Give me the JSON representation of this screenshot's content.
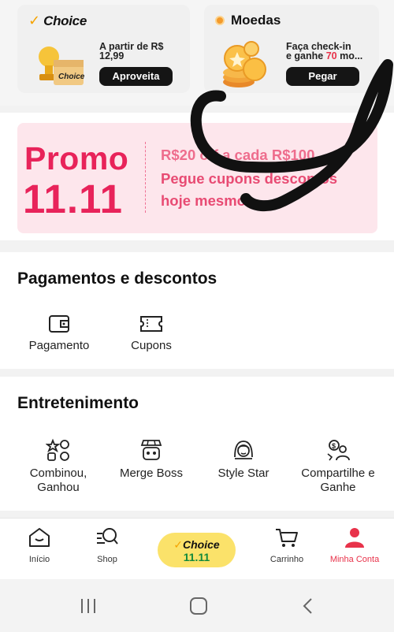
{
  "cards": {
    "choice": {
      "title": "Choice",
      "line1": "A partir de R$",
      "line2": "12,99",
      "button": "Aproveita"
    },
    "coins": {
      "title": "Moedas",
      "line1": "Faça check-in",
      "line2_prefix": "e ganhe ",
      "line2_highlight": "70",
      "line2_suffix": " mo...",
      "button": "Pegar"
    }
  },
  "promo": {
    "word": "Promo",
    "number": "11.11",
    "line1": "R$20 off a cada R$100",
    "line2": "Pegue cupons descontos",
    "line3": "hoje mesmo →"
  },
  "payments": {
    "title": "Pagamentos e descontos",
    "items": [
      {
        "label": "Pagamento",
        "icon": "wallet-icon"
      },
      {
        "label": "Cupons",
        "icon": "ticket-icon"
      }
    ]
  },
  "entertainment": {
    "title": "Entretenimento",
    "items": [
      {
        "label_line1": "Combinou,",
        "label_line2": "Ganhou",
        "icon": "match-game-icon"
      },
      {
        "label_line1": "Merge Boss",
        "label_line2": "",
        "icon": "shop-robot-icon"
      },
      {
        "label_line1": "Style Star",
        "label_line2": "",
        "icon": "girl-face-icon"
      },
      {
        "label_line1": "Compartilhe e",
        "label_line2": "Ganhe",
        "icon": "share-money-icon"
      }
    ]
  },
  "bottom_nav": {
    "items": [
      {
        "label": "Início",
        "icon": "home-icon"
      },
      {
        "label": "Shop",
        "icon": "search-icon"
      },
      {
        "label": "Carrinho",
        "icon": "cart-icon"
      },
      {
        "label": "Minha Conta",
        "icon": "user-icon"
      }
    ],
    "choice_pill": {
      "brand": "Choice",
      "event": "11.11"
    }
  },
  "system_nav": {
    "items": [
      "recent-apps-icon",
      "home-button-icon",
      "back-icon"
    ]
  },
  "colors": {
    "accent_red": "#e8324a",
    "promo_pink": "#e8235a",
    "choice_yellow": "#fbe26a",
    "choice_check": "#f5a300"
  }
}
